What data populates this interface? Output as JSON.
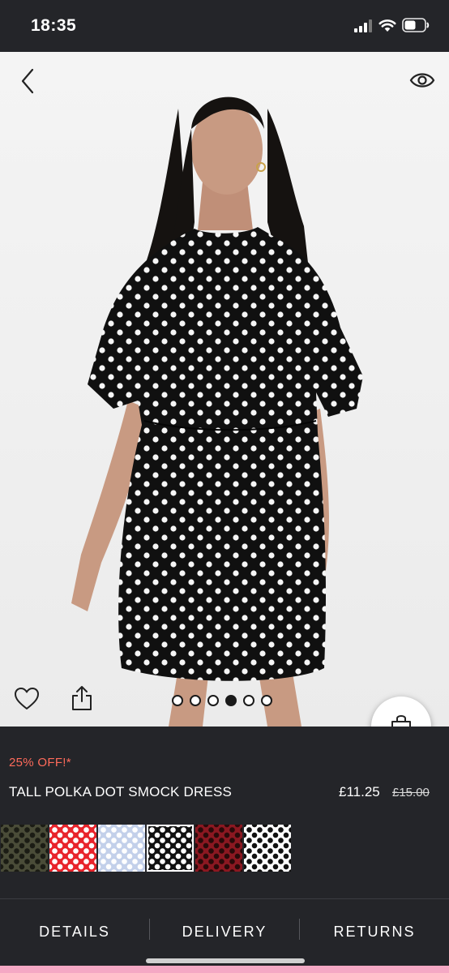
{
  "status_bar": {
    "time": "18:35"
  },
  "product_gallery": {
    "image_count": 6,
    "active_index": 3,
    "image_alt": "Model wearing black polka dot smock dress"
  },
  "product": {
    "discount": "25% OFF!*",
    "title": "TALL POLKA DOT SMOCK DRESS",
    "price": "£11.25",
    "old_price": "£15.00"
  },
  "swatches": [
    {
      "name": "khaki",
      "bg": "#4a4c38",
      "dot": "#1b1c14"
    },
    {
      "name": "red",
      "bg": "#e8242b",
      "dot": "#ffffff"
    },
    {
      "name": "light-blue",
      "bg": "#c3d0ea",
      "dot": "#ffffff"
    },
    {
      "name": "black",
      "bg": "#111111",
      "dot": "#ffffff",
      "selected": true
    },
    {
      "name": "burgundy",
      "bg": "#8b1821",
      "dot": "#2a0a0a"
    },
    {
      "name": "white",
      "bg": "#ffffff",
      "dot": "#111111"
    }
  ],
  "tabs": [
    {
      "label": "DETAILS"
    },
    {
      "label": "DELIVERY"
    },
    {
      "label": "RETURNS"
    }
  ],
  "colors": {
    "accent": "#ff6b5b",
    "background": "#242529"
  }
}
